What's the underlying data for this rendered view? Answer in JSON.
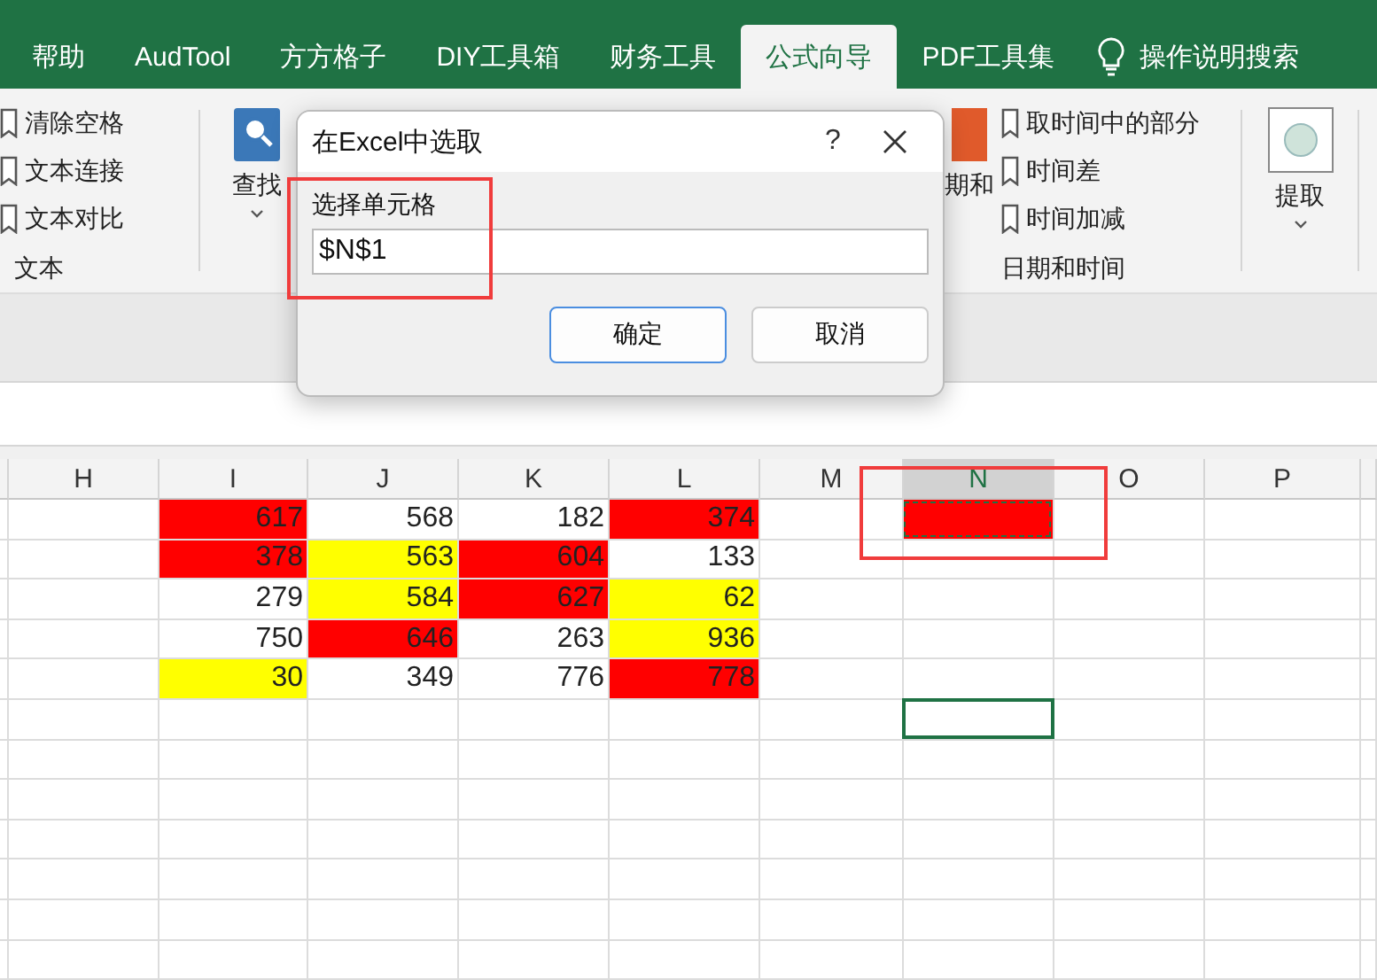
{
  "tabs": [
    {
      "label": "帮助",
      "selected": false
    },
    {
      "label": "AudTool",
      "selected": false
    },
    {
      "label": "方方格子",
      "selected": false
    },
    {
      "label": "DIY工具箱",
      "selected": false
    },
    {
      "label": "财务工具",
      "selected": false
    },
    {
      "label": "公式向导",
      "selected": true
    },
    {
      "label": "PDF工具集",
      "selected": false
    }
  ],
  "search": {
    "label": "操作说明搜索"
  },
  "ribbon": {
    "text_group": {
      "items": [
        "清除空格",
        "文本连接",
        "文本对比"
      ],
      "label": "文本"
    },
    "find_button": {
      "label": "查找"
    },
    "date_button": {
      "label": "期和"
    },
    "date_group": {
      "items": [
        "取时间中的部分",
        "时间差",
        "时间加减"
      ],
      "label": "日期和时间"
    },
    "extract_button": {
      "label": "提取"
    }
  },
  "dialog": {
    "title": "在Excel中选取",
    "help": "?",
    "field_label": "选择单元格",
    "value": "$N$1",
    "buttons": [
      {
        "label": "确定",
        "default": true
      },
      {
        "label": "取消",
        "default": false
      }
    ]
  },
  "grid": {
    "columns": [
      {
        "label": "H",
        "selected": false
      },
      {
        "label": "I",
        "selected": false
      },
      {
        "label": "J",
        "selected": false
      },
      {
        "label": "K",
        "selected": false
      },
      {
        "label": "L",
        "selected": false
      },
      {
        "label": "M",
        "selected": false
      },
      {
        "label": "N",
        "selected": true
      },
      {
        "label": "O",
        "selected": false
      },
      {
        "label": "P",
        "selected": false
      }
    ],
    "rows": [
      {
        "cells": [
          {
            "value": "617",
            "color": "#ff0000"
          },
          {
            "value": "568"
          },
          {
            "value": "182"
          },
          {
            "value": "374",
            "color": "#ff0000"
          }
        ]
      },
      {
        "cells": [
          {
            "value": "378",
            "color": "#ff0000"
          },
          {
            "value": "563",
            "color": "#ffff00"
          },
          {
            "value": "604",
            "color": "#ff0000"
          },
          {
            "value": "133"
          }
        ]
      },
      {
        "cells": [
          {
            "value": "279"
          },
          {
            "value": "584",
            "color": "#ffff00"
          },
          {
            "value": "627",
            "color": "#ff0000"
          },
          {
            "value": "62",
            "color": "#ffff00"
          }
        ]
      },
      {
        "cells": [
          {
            "value": "750"
          },
          {
            "value": "646",
            "color": "#ff0000"
          },
          {
            "value": "263"
          },
          {
            "value": "936",
            "color": "#ffff00"
          }
        ]
      },
      {
        "cells": [
          {
            "value": "30",
            "color": "#ffff00"
          },
          {
            "value": "349"
          },
          {
            "value": "776"
          },
          {
            "value": "778",
            "color": "#ff0000"
          }
        ]
      }
    ],
    "marquee_cell": {
      "color": "#ff0000"
    }
  }
}
